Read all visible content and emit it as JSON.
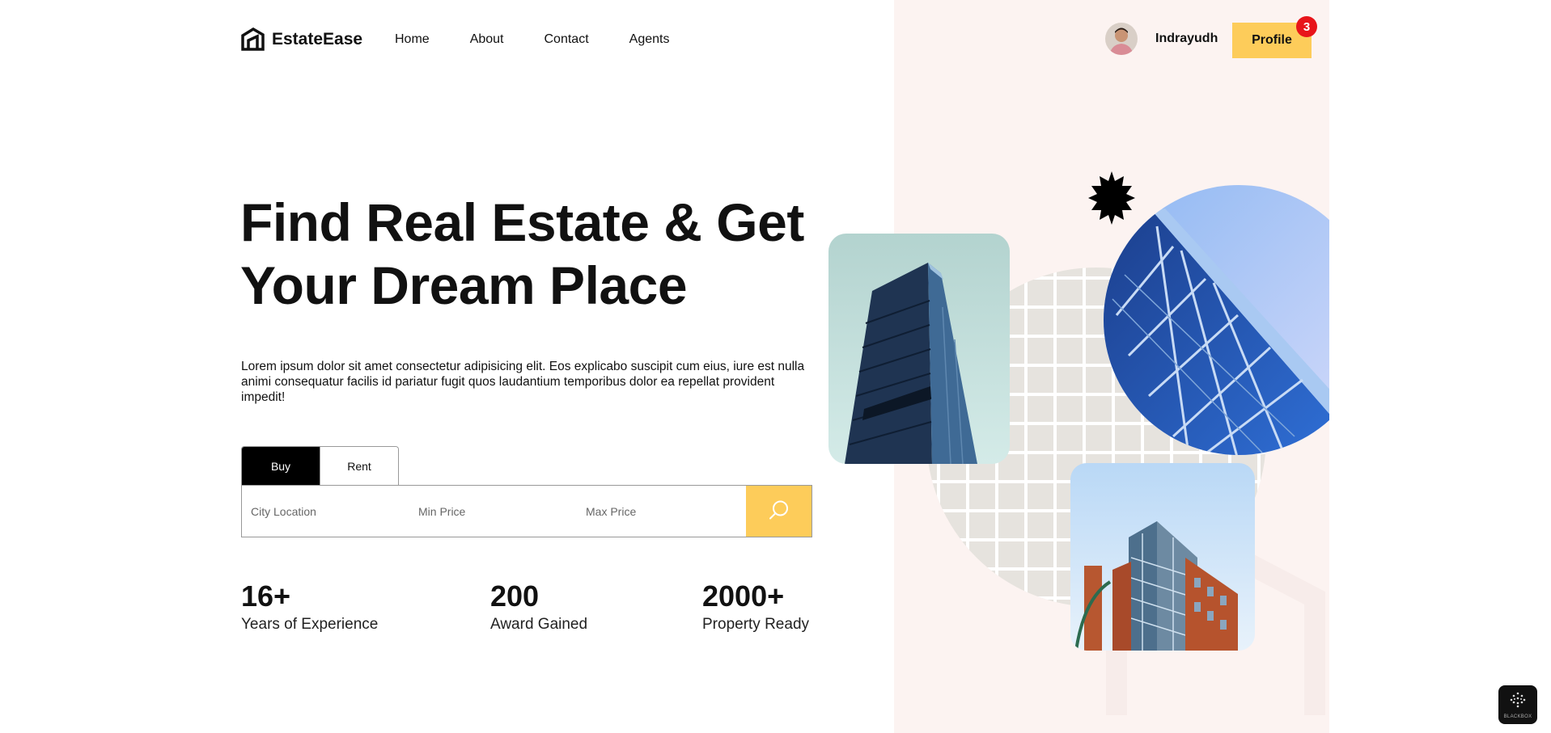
{
  "brand": {
    "name": "EstateEase",
    "logo_icon": "house-logo-icon"
  },
  "nav": {
    "items": [
      "Home",
      "About",
      "Contact",
      "Agents"
    ]
  },
  "user": {
    "name": "Indrayudh",
    "avatar_icon": "user-avatar"
  },
  "profile": {
    "label": "Profile",
    "badge_count": "3"
  },
  "hero": {
    "title_line1": "Find Real Estate & Get",
    "title_line2": "Your Dream Place",
    "description": "Lorem ipsum dolor sit amet consectetur adipisicing elit. Eos explicabo suscipit cum eius, iure est nulla animi consequatur facilis id pariatur fugit quos laudantium temporibus dolor ea repellat provident impedit!"
  },
  "search": {
    "tabs": [
      {
        "label": "Buy",
        "active": true
      },
      {
        "label": "Rent",
        "active": false
      }
    ],
    "fields": {
      "city_placeholder": "City Location",
      "min_placeholder": "Min Price",
      "max_placeholder": "Max Price"
    },
    "button_icon": "search-icon"
  },
  "stats": [
    {
      "value": "16+",
      "label": "Years of Experience"
    },
    {
      "value": "200",
      "label": "Award Gained"
    },
    {
      "value": "2000+",
      "label": "Property Ready"
    }
  ],
  "widget": {
    "label": "BLACKBOX"
  },
  "colors": {
    "accent": "#fdcc5a",
    "panel_bg": "#fcf3f1",
    "badge": "#e8141a",
    "dark": "#111111"
  }
}
